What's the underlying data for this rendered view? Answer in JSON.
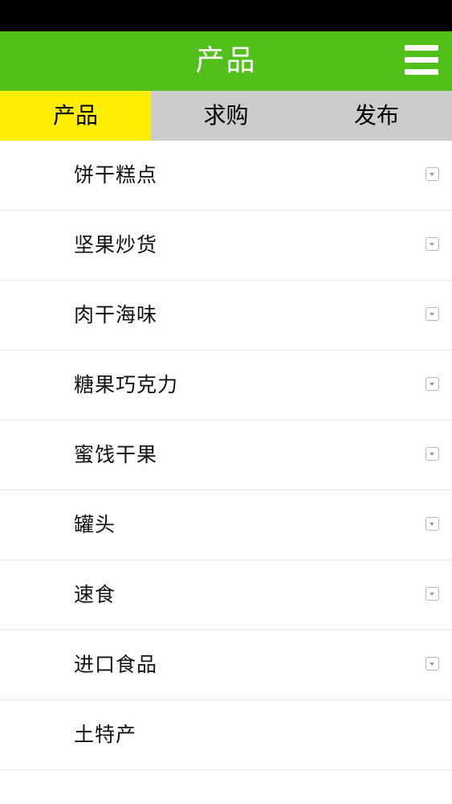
{
  "header": {
    "title": "产品"
  },
  "tabs": [
    {
      "label": "产品",
      "active": true
    },
    {
      "label": "求购",
      "active": false
    },
    {
      "label": "发布",
      "active": false
    }
  ],
  "categories": [
    {
      "label": "饼干糕点",
      "expandable": true
    },
    {
      "label": "坚果炒货",
      "expandable": true
    },
    {
      "label": "肉干海味",
      "expandable": true
    },
    {
      "label": "糖果巧克力",
      "expandable": true
    },
    {
      "label": "蜜饯干果",
      "expandable": true
    },
    {
      "label": "罐头",
      "expandable": true
    },
    {
      "label": "速食",
      "expandable": true
    },
    {
      "label": "进口食品",
      "expandable": true
    },
    {
      "label": "土特产",
      "expandable": false
    }
  ],
  "colors": {
    "header_bg": "#52c01a",
    "active_tab_bg": "#ffee00",
    "inactive_tab_bg": "#cccccc",
    "status_bar_bg": "#000000"
  }
}
